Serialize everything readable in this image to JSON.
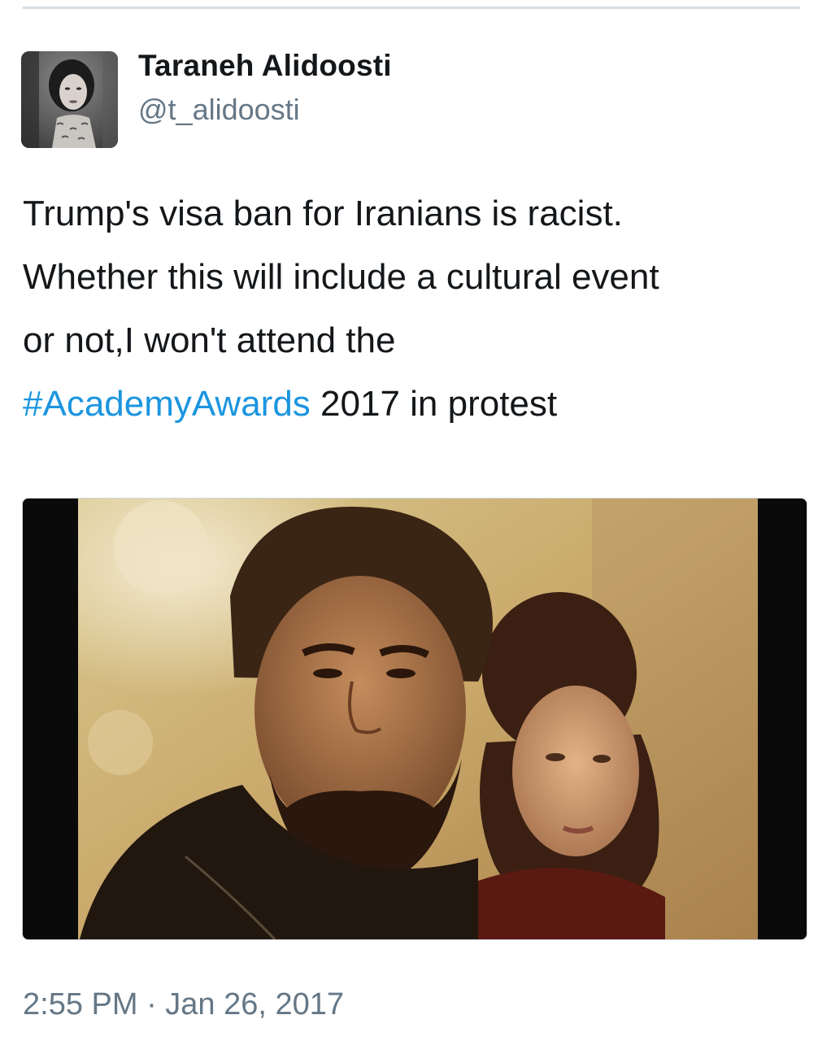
{
  "tweet": {
    "author": {
      "display_name": "Taraneh Alidoosti",
      "handle": "@t_alidoosti"
    },
    "text_lines": [
      "Trump's visa ban for Iranians is racist.",
      "Whether this will include a cultural event",
      "or not,I won't attend the"
    ],
    "last_line": {
      "hashtag": "#AcademyAwards",
      "rest": " 2017 in protest"
    },
    "timestamp": "2:55 PM · Jan 26, 2017"
  },
  "icons": {
    "avatar": "avatar-photo",
    "media": "film-still-photo"
  },
  "colors": {
    "text": "#14171a",
    "secondary": "#657786",
    "hashtag": "#1b95e0"
  }
}
